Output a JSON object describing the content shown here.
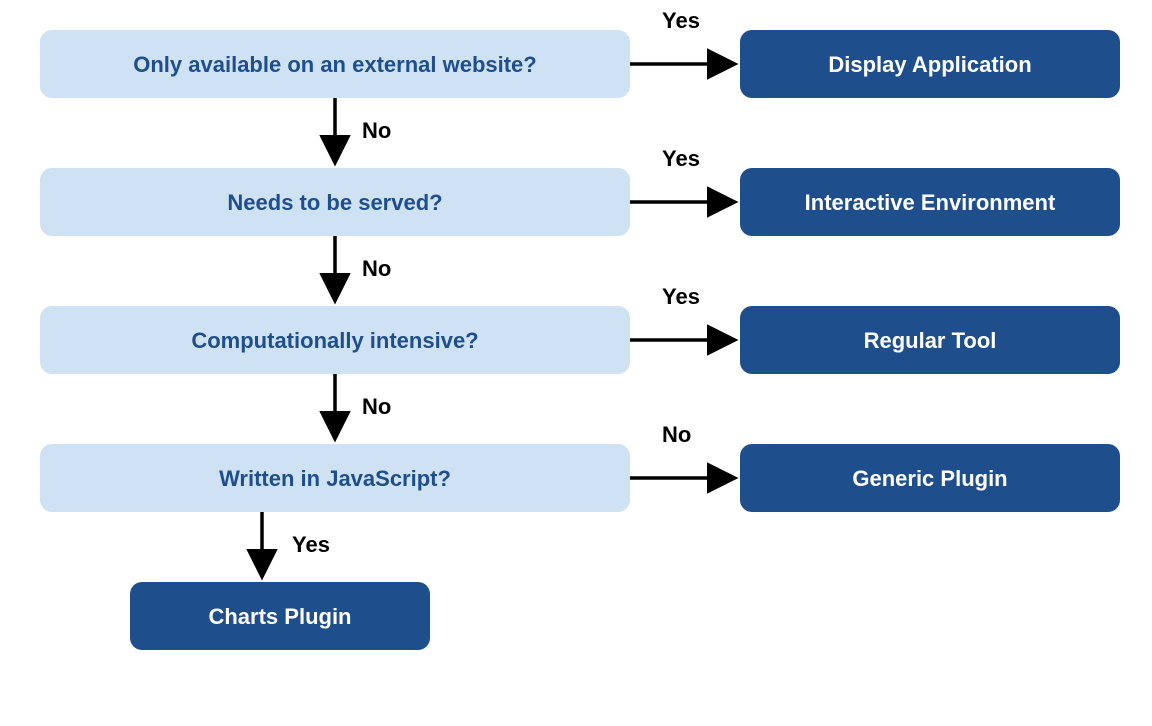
{
  "diagram": {
    "type": "decision-flowchart",
    "questions": [
      {
        "id": 1,
        "text": "Only available on an external website?",
        "yes_target": "Display Application",
        "no_target": 2
      },
      {
        "id": 2,
        "text": "Needs to be served?",
        "yes_target": "Interactive Environment",
        "no_target": 3
      },
      {
        "id": 3,
        "text": "Computationally intensive?",
        "yes_target": "Regular Tool",
        "no_target": 4
      },
      {
        "id": 4,
        "text": "Written in JavaScript?",
        "no_target": "Generic Plugin",
        "yes_target": "Charts Plugin"
      }
    ],
    "answers": [
      "Display Application",
      "Interactive Environment",
      "Regular Tool",
      "Generic Plugin",
      "Charts Plugin"
    ],
    "edge_labels": {
      "yes": "Yes",
      "no": "No"
    },
    "rows": {
      "r1_right": "Yes",
      "r1_down": "No",
      "r2_right": "Yes",
      "r2_down": "No",
      "r3_right": "Yes",
      "r3_down": "No",
      "r4_right": "No",
      "r4_down": "Yes"
    },
    "colors": {
      "question_bg": "#cfe2f3",
      "question_text": "#1f4e8c",
      "answer_bg": "#1f4e8c",
      "answer_text": "#ffffff",
      "arrow": "#000000"
    }
  }
}
